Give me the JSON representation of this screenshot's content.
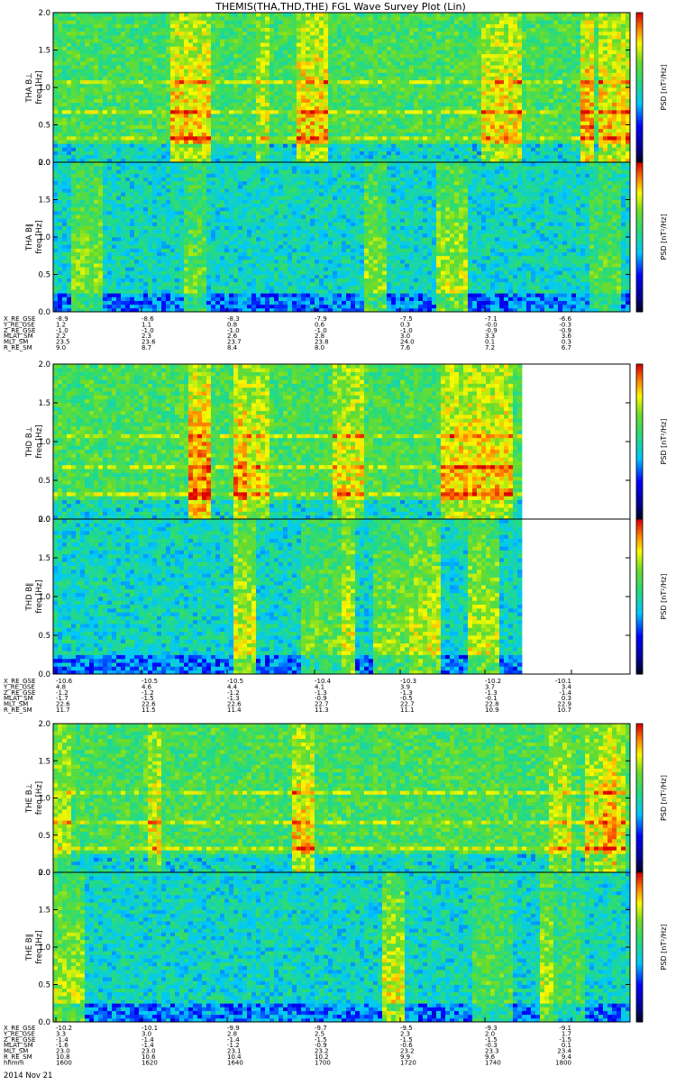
{
  "title": "THEMIS(THA,THD,THE) FGL Wave Survey Plot (Lin)",
  "chart_data": [
    {
      "type": "heatmap",
      "probe": "THA",
      "panels": [
        {
          "ylabel": "THA B⊥",
          "ylim": [
            0,
            2.0
          ],
          "yticks": [
            "0.0",
            "0.5",
            "1.0",
            "1.5",
            "2.0"
          ],
          "valid_fraction": 1.0
        },
        {
          "ylabel": "THA B∥",
          "ylim": [
            0,
            2.0
          ],
          "yticks": [
            "0.0",
            "0.5",
            "1.0",
            "1.5",
            "2.0"
          ],
          "valid_fraction": 1.0
        }
      ],
      "freq_unit": "freq [Hz]",
      "colorbar": {
        "label": "PSD [nT²/Hz]",
        "scale": "log",
        "colors": [
          "black",
          "blue",
          "cyan",
          "green",
          "yellow",
          "red"
        ]
      },
      "ephemeris": {
        "labels": [
          "X_RE_GSE",
          "Y_RE_GSE",
          "Z_RE_GSE",
          "MLAT_SM",
          "MLT_SM",
          "R_RE_SM"
        ],
        "columns": [
          [
            "-8.9",
            "1.2",
            "-1.0",
            "2.2",
            "23.5",
            "9.0"
          ],
          [
            "-8.6",
            "1.1",
            "-1.0",
            "2.3",
            "23.6",
            "8.7"
          ],
          [
            "-8.3",
            "0.8",
            "-1.0",
            "2.6",
            "23.7",
            "8.4"
          ],
          [
            "-7.9",
            "0.6",
            "-1.0",
            "2.8",
            "23.8",
            "8.0"
          ],
          [
            "-7.5",
            "0.3",
            "-1.0",
            "3.0",
            "24.0",
            "7.6"
          ],
          [
            "-7.1",
            "-0.0",
            "-0.9",
            "3.3",
            "0.1",
            "7.2"
          ],
          [
            "-6.6",
            "-0.3",
            "-0.9",
            "3.6",
            "0.3",
            "6.7"
          ]
        ]
      }
    },
    {
      "type": "heatmap",
      "probe": "THD",
      "panels": [
        {
          "ylabel": "THD B⊥",
          "ylim": [
            0,
            2.0
          ],
          "yticks": [
            "0.0",
            "0.5",
            "1.0",
            "1.5",
            "2.0"
          ],
          "valid_fraction": 0.81
        },
        {
          "ylabel": "THD B∥",
          "ylim": [
            0,
            2.0
          ],
          "yticks": [
            "0.0",
            "0.5",
            "1.0",
            "1.5",
            "2.0"
          ],
          "valid_fraction": 0.81
        }
      ],
      "freq_unit": "freq [Hz]",
      "colorbar": {
        "label": "PSD [nT²/Hz]",
        "scale": "log",
        "colors": [
          "black",
          "blue",
          "cyan",
          "green",
          "yellow",
          "red"
        ]
      },
      "ephemeris": {
        "labels": [
          "X_RE_GSE",
          "Y_RE_GSE",
          "Z_RE_GSE",
          "MLAT_SM",
          "MLT_SM",
          "R_RE_SM"
        ],
        "columns": [
          [
            "-10.6",
            "4.8",
            "-1.2",
            "-1.7",
            "22.6",
            "11.7"
          ],
          [
            "-10.5",
            "4.6",
            "-1.2",
            "-1.5",
            "22.6",
            "11.5"
          ],
          [
            "-10.5",
            "4.4",
            "-1.2",
            "-1.3",
            "22.6",
            "11.4"
          ],
          [
            "-10.4",
            "4.1",
            "-1.3",
            "-0.9",
            "22.7",
            "11.3"
          ],
          [
            "-10.3",
            "3.9",
            "-1.3",
            "-0.5",
            "22.7",
            "11.1"
          ],
          [
            "-10.2",
            "3.7",
            "-1.3",
            "-0.1",
            "22.8",
            "10.9"
          ],
          [
            "-10.1",
            "3.4",
            "-1.4",
            "0.3",
            "22.9",
            "10.7"
          ]
        ]
      }
    },
    {
      "type": "heatmap",
      "probe": "THE",
      "panels": [
        {
          "ylabel": "THE B⊥",
          "ylim": [
            0,
            2.0
          ],
          "yticks": [
            "0.0",
            "0.5",
            "1.0",
            "1.5",
            "2.0"
          ],
          "valid_fraction": 1.0
        },
        {
          "ylabel": "THE B∥",
          "ylim": [
            0,
            2.0
          ],
          "yticks": [
            "0.0",
            "0.5",
            "1.0",
            "1.5",
            "2.0"
          ],
          "valid_fraction": 1.0
        }
      ],
      "freq_unit": "freq [Hz]",
      "colorbar": {
        "label": "PSD [nT²/Hz]",
        "scale": "log",
        "colors": [
          "black",
          "blue",
          "cyan",
          "green",
          "yellow",
          "red"
        ]
      },
      "ephemeris": {
        "labels": [
          "X_RE_GSE",
          "Y_RE_GSE",
          "Z_RE_GSE",
          "MLAT_SM",
          "MLT_SM",
          "R_RE_SM",
          "hhmm"
        ],
        "columns": [
          [
            "-10.2",
            "3.3",
            "-1.4",
            "-1.6",
            "23.0",
            "10.8",
            "1600"
          ],
          [
            "-10.1",
            "3.0",
            "-1.4",
            "-1.4",
            "23.0",
            "10.6",
            "1620"
          ],
          [
            "-9.9",
            "2.8",
            "-1.4",
            "-1.2",
            "23.1",
            "10.4",
            "1640"
          ],
          [
            "-9.7",
            "2.5",
            "-1.5",
            "-0.9",
            "23.2",
            "10.2",
            "1700"
          ],
          [
            "-9.5",
            "2.3",
            "-1.5",
            "-0.6",
            "23.2",
            "9.9",
            "1720"
          ],
          [
            "-9.3",
            "2.0",
            "-1.5",
            "-0.3",
            "23.3",
            "9.6",
            "1740"
          ],
          [
            "-9.1",
            "1.7",
            "-1.5",
            "0.1",
            "23.4",
            "9.4",
            "1800"
          ]
        ]
      }
    }
  ],
  "date_label": "2014 Nov 21"
}
